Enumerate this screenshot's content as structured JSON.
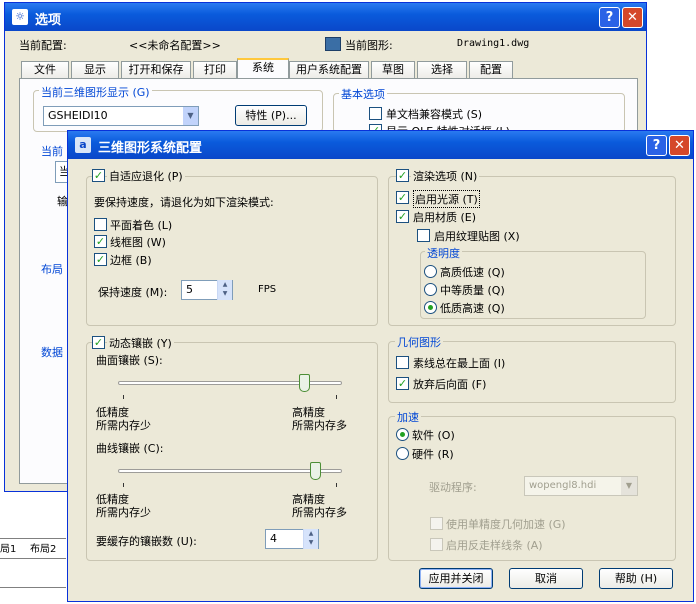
{
  "options_dialog": {
    "title": "选项",
    "current_config_label": "当前配置:",
    "current_config_value": "<<未命名配置>>",
    "current_drawing_label": "当前图形:",
    "current_drawing_value": "Drawing1.dwg",
    "tabs": [
      "文件",
      "显示",
      "打开和保存",
      "打印",
      "系统",
      "用户系统配置",
      "草图",
      "选择",
      "配置"
    ],
    "active_tab": "系统",
    "group_3d_display": "当前三维图形显示 (G)",
    "driver_value": "GSHEIDI10",
    "properties_button": "特性 (P)...",
    "group_basic": "基本选项",
    "single_doc_compat": "单文档兼容模式 (S)",
    "show_ole": "显示 OLE 特性对话框 (L)",
    "group_current_partial": "当前",
    "current_partial_text": "当",
    "output_partial": "输",
    "group_layout_partial": "布局",
    "group_db_partial": "数据",
    "close_button_char": "✕",
    "help_button_char": "?"
  },
  "bg_tabs": [
    "局1",
    "布局2"
  ],
  "adaptive_dialog": {
    "title": "三维图形系统配置",
    "adaptive_degradation": "自适应退化 (P)",
    "keep_speed_text": "要保持速度，请退化为如下渲染模式:",
    "flat_shaded": "平面着色 (L)",
    "wireframe": "线框图 (W)",
    "edges": "边框 (B)",
    "maintain_speed_label": "保持速度 (M):",
    "maintain_speed_value": "5",
    "fps": "FPS",
    "render_options": "渲染选项 (N)",
    "enable_lights": "启用光源 (T)",
    "enable_materials": "启用材质 (E)",
    "enable_texture_maps": "启用纹理贴图 (X)",
    "transparency_label": "透明度",
    "high_quality": "高质低速 (Q)",
    "medium_quality": "中等质量 (Q)",
    "low_quality": "低质高速 (Q)",
    "dynamic_tessellation": "动态镶嵌 (Y)",
    "surface_tessellation": "曲面镶嵌 (S):",
    "low_precision": "低精度",
    "less_memory": "所需内存少",
    "high_precision": "高精度",
    "more_memory": "所需内存多",
    "curve_tessellation": "曲线镶嵌 (C):",
    "cached_tessellations_label": "要缓存的镶嵌数 (U):",
    "cached_tessellations_value": "4",
    "geometry_label": "几何图形",
    "isolines_on_top": "素线总在最上面 (I)",
    "discard_backfaces": "放弃后向面 (F)",
    "acceleration_label": "加速",
    "software": "软件 (O)",
    "hardware": "硬件 (R)",
    "driver_label": "驱动程序:",
    "driver_value": "wopengl8.hdi",
    "single_precision_accel": "使用单精度几何加速 (G)",
    "antialias_lines": "启用反走样线条 (A)",
    "apply_close_button": "应用并关闭",
    "cancel_button": "取消",
    "help_button": "帮助 (H)",
    "help_title_char": "?",
    "close_title_char": "✕",
    "surface_slider_level": 0.85,
    "curve_slider_level": 0.9
  },
  "colors": {
    "title_blue": "#0A5BDC",
    "dialog_bg": "#ECE9D8",
    "group_label": "#0046D5",
    "check_green": "#21A121",
    "close_red": "#D5482A"
  }
}
